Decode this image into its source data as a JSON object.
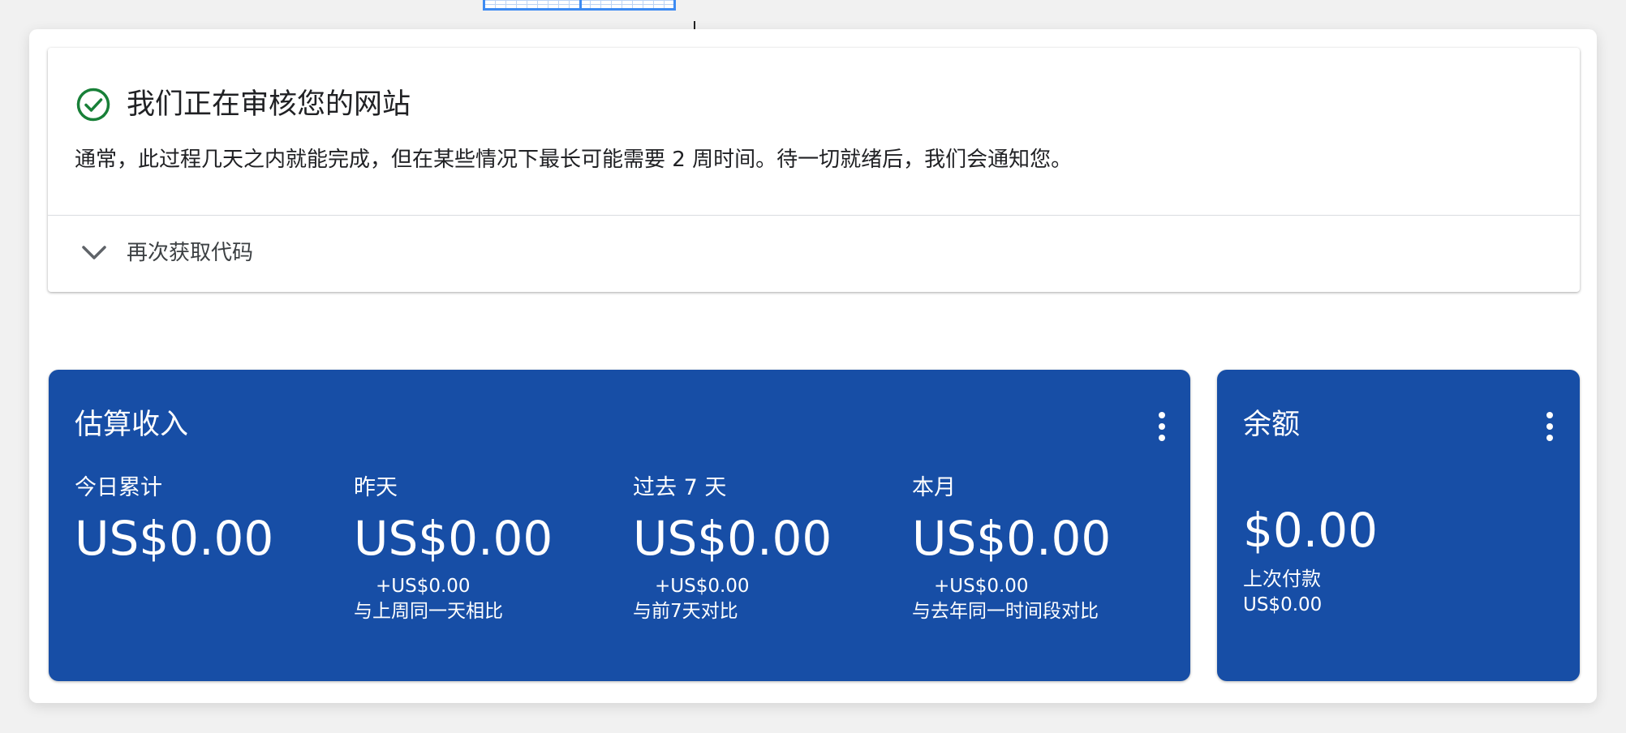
{
  "review": {
    "title": "我们正在审核您的网站",
    "description": "通常，此过程几天之内就能完成，但在某些情况下最长可能需要 2 周时间。待一切就绪后，我们会通知您。",
    "get_code_label": "再次获取代码",
    "status_color": "#188038"
  },
  "earnings": {
    "title": "估算收入",
    "accent_color": "#174ea6",
    "metrics": [
      {
        "label": "今日累计",
        "value": "US$0.00",
        "delta": "",
        "compare": ""
      },
      {
        "label": "昨天",
        "value": "US$0.00",
        "delta": "+US$0.00",
        "compare": "与上周同一天相比"
      },
      {
        "label": "过去 7 天",
        "value": "US$0.00",
        "delta": "+US$0.00",
        "compare": "与前7天对比"
      },
      {
        "label": "本月",
        "value": "US$0.00",
        "delta": "+US$0.00",
        "compare": "与去年同一时间段对比"
      }
    ]
  },
  "balance": {
    "title": "余额",
    "value": "$0.00",
    "last_payment_label": "上次付款",
    "last_payment_value": "US$0.00"
  },
  "icons": {
    "status": "check-circle-icon",
    "expand": "chevron-down-icon",
    "menu": "more-vert-icon",
    "cursor": "crosshair-cursor-icon"
  }
}
